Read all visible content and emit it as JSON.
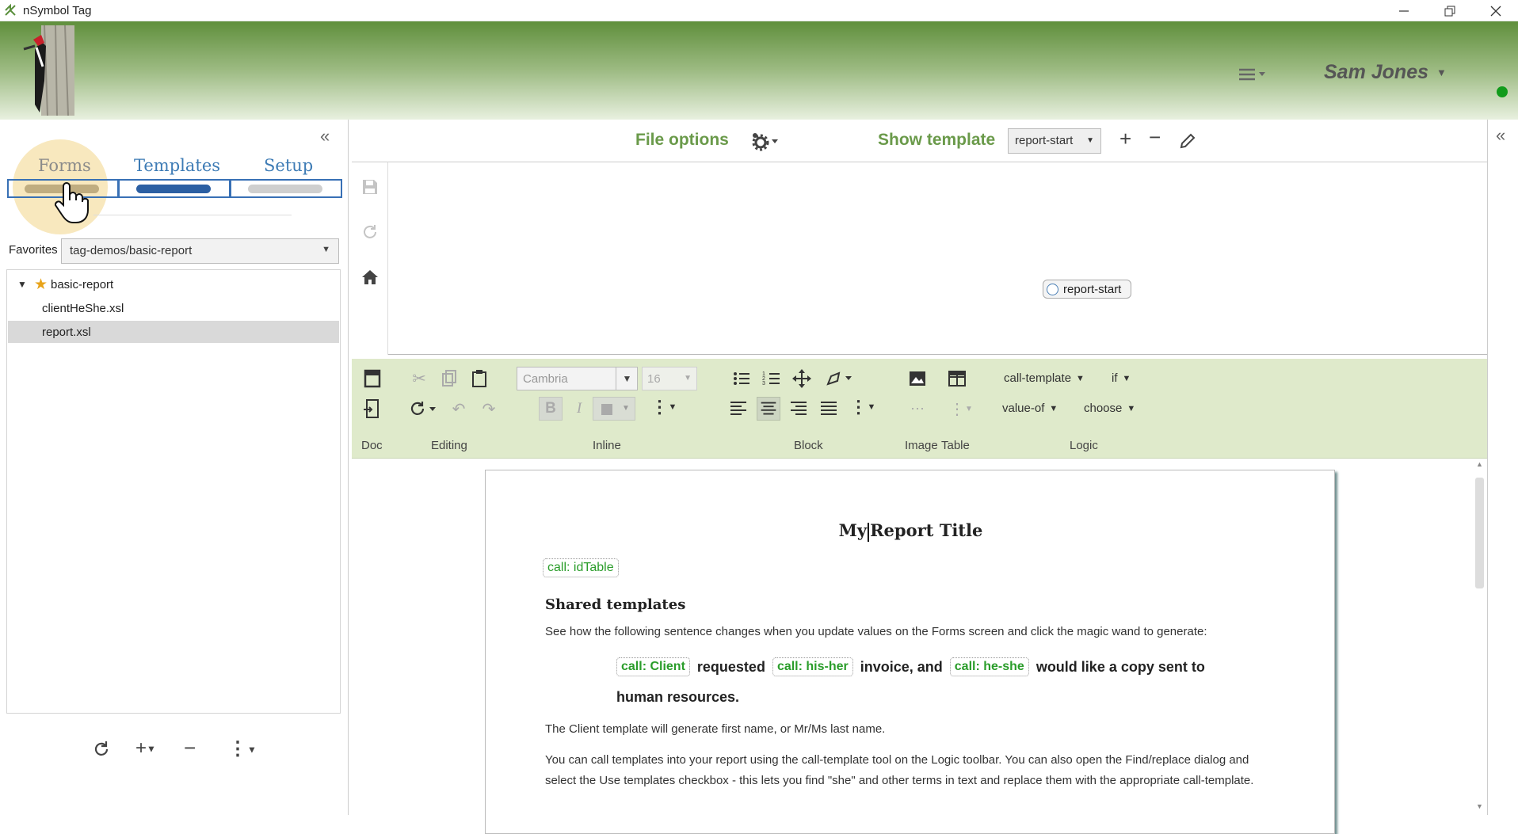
{
  "window": {
    "title": "nSymbol Tag"
  },
  "header": {
    "user_name": "Sam Jones"
  },
  "left": {
    "tabs": [
      "Forms",
      "Templates",
      "Setup"
    ],
    "favorites_label": "Favorites",
    "favorites_value": "tag-demos/basic-report",
    "tree": [
      {
        "label": "basic-report",
        "starred": true,
        "expanded": true
      },
      {
        "label": "clientHeShe.xsl",
        "starred": false
      },
      {
        "label": "report.xsl",
        "starred": false,
        "selected": true
      }
    ]
  },
  "toolbar": {
    "file_options": "File options",
    "show_template": "Show template",
    "template_value": "report-start"
  },
  "preview": {
    "chip": "report-start"
  },
  "ribbon": {
    "font": "Cambria",
    "size": "16",
    "groups": [
      "Doc",
      "Editing",
      "Inline",
      "Block",
      "Image",
      "Table",
      "Logic"
    ],
    "logic": {
      "call_template": "call-template",
      "if": "if",
      "value_of": "value-of",
      "choose": "choose"
    }
  },
  "document": {
    "title_part1": "My",
    "title_part2": "Report Title",
    "call_idtable": "call: idTable",
    "heading": "Shared templates",
    "para1": "See how the following sentence changes when you update values on the Forms screen and click the magic wand to generate:",
    "call_client": "call: Client",
    "word_requested": "requested",
    "call_hisher": "call: his-her",
    "word_invoice": "invoice, and",
    "call_heshe": "call: he-she",
    "word_would": "would like a copy sent to",
    "word_hr": "human resources.",
    "para2": "The Client template will generate first name, or Mr/Ms last name.",
    "para3a": "You can call templates into your report using the call-template tool on the Logic toolbar. You can also open the Find/replace dialog and",
    "para3b": "select the Use templates checkbox - this lets you find \"she\" and other terms in text and replace them with the appropriate call-template."
  },
  "colors": {
    "accent_green": "#6a9a4a",
    "tab_blue": "#3d7bb5",
    "call_green": "#2a9d2a",
    "status_online": "#119b1b"
  }
}
